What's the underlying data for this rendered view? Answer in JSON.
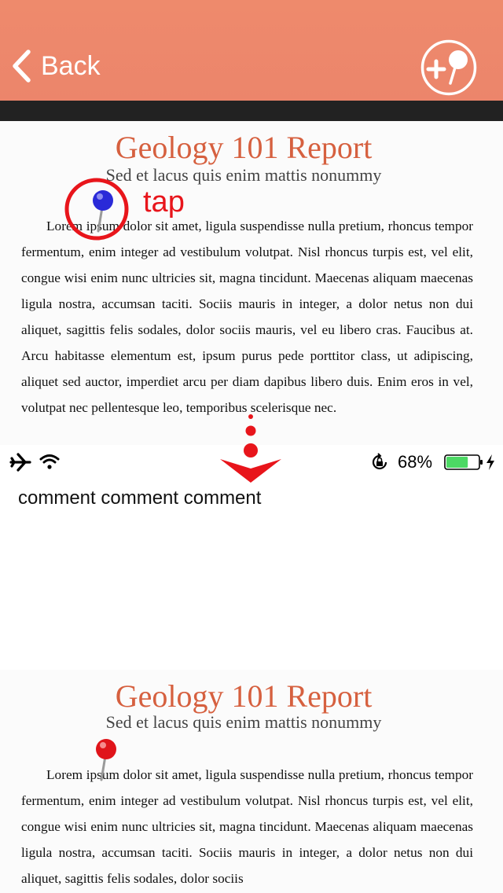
{
  "nav": {
    "back_label": "Back",
    "add_pin_icon": "add-pin-icon"
  },
  "colors": {
    "nav_bg": "#ec856b",
    "title": "#d6603f",
    "annotation": "#e8151b",
    "pin_blue": "#2a2ad8",
    "pin_red": "#e0141a",
    "battery": "#4cd964"
  },
  "doc_top": {
    "title": "Geology 101 Report",
    "subtitle": "Sed et lacus quis enim mattis nonummy",
    "body": "Lorem ipsum dolor sit amet, ligula suspendisse nulla pretium, rhoncus tempor fermentum, enim integer ad vestibulum volutpat. Nisl rhoncus turpis est, vel elit, congue wisi enim nunc ultricies sit, magna tincidunt. Maecenas aliquam maecenas ligula nostra, accumsan taciti. Sociis mauris in integer, a dolor netus non dui aliquet, sagittis felis sodales, dolor sociis mauris, vel eu libero cras. Faucibus at. Arcu habitasse elementum est, ipsum purus pede porttitor class, ut adipiscing, aliquet sed auctor, imperdiet arcu per diam dapibus libero duis. Enim eros in vel, volutpat nec pellentesque leo, temporibus scelerisque nec."
  },
  "annotation": {
    "tap_label": "tap"
  },
  "status": {
    "battery_percent": "68%",
    "battery_level": 0.68
  },
  "comment": "comment comment comment",
  "doc_bottom": {
    "title": "Geology 101 Report",
    "subtitle": "Sed et lacus quis enim mattis nonummy",
    "body": "Lorem ipsum dolor sit amet, ligula suspendisse nulla pretium, rhoncus tempor fermentum, enim integer ad vestibulum volutpat. Nisl rhoncus turpis est, vel elit, congue wisi enim nunc ultricies sit, magna tincidunt. Maecenas aliquam maecenas ligula nostra, accumsan taciti. Sociis mauris in integer, a dolor netus non dui aliquet, sagittis felis sodales, dolor sociis"
  }
}
